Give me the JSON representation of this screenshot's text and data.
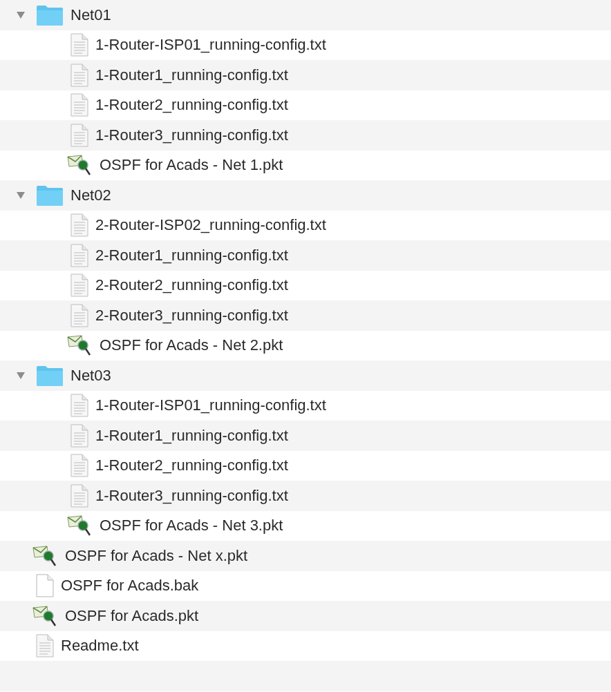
{
  "files": [
    {
      "name": "Net01",
      "kind": "folder",
      "expanded": true,
      "children": [
        {
          "name": "1-Router-ISP01_running-config.txt",
          "kind": "text"
        },
        {
          "name": "1-Router1_running-config.txt",
          "kind": "text"
        },
        {
          "name": "1-Router2_running-config.txt",
          "kind": "text"
        },
        {
          "name": "1-Router3_running-config.txt",
          "kind": "text"
        },
        {
          "name": "OSPF for Acads - Net 1.pkt",
          "kind": "packet"
        }
      ]
    },
    {
      "name": "Net02",
      "kind": "folder",
      "expanded": true,
      "children": [
        {
          "name": "2-Router-ISP02_running-config.txt",
          "kind": "text"
        },
        {
          "name": "2-Router1_running-config.txt",
          "kind": "text"
        },
        {
          "name": "2-Router2_running-config.txt",
          "kind": "text"
        },
        {
          "name": "2-Router3_running-config.txt",
          "kind": "text"
        },
        {
          "name": "OSPF for Acads - Net 2.pkt",
          "kind": "packet"
        }
      ]
    },
    {
      "name": "Net03",
      "kind": "folder",
      "expanded": true,
      "children": [
        {
          "name": "1-Router-ISP01_running-config.txt",
          "kind": "text"
        },
        {
          "name": "1-Router1_running-config.txt",
          "kind": "text"
        },
        {
          "name": "1-Router2_running-config.txt",
          "kind": "text"
        },
        {
          "name": "1-Router3_running-config.txt",
          "kind": "text"
        },
        {
          "name": "OSPF for Acads - Net 3.pkt",
          "kind": "packet"
        }
      ]
    },
    {
      "name": "OSPF for Acads - Net x.pkt",
      "kind": "packet"
    },
    {
      "name": "OSPF for Acads.bak",
      "kind": "blank"
    },
    {
      "name": "OSPF for Acads.pkt",
      "kind": "packet"
    },
    {
      "name": "Readme.txt",
      "kind": "text"
    }
  ]
}
